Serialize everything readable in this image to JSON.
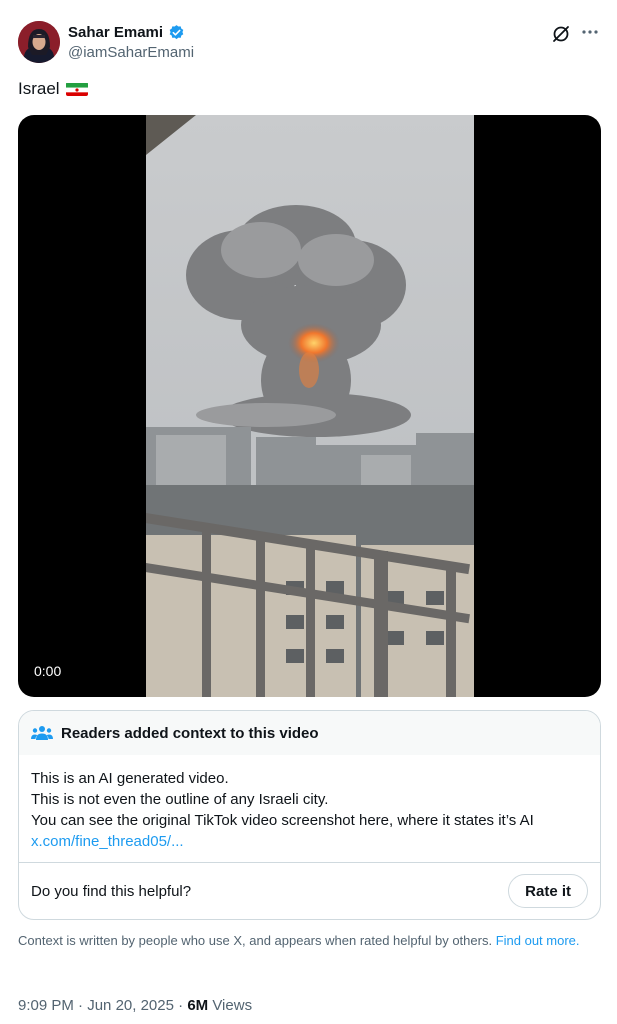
{
  "author": {
    "display_name": "Sahar Emami",
    "handle": "@iamSaharEmami",
    "verified": true
  },
  "header_icons": [
    "grok-icon",
    "more-options-icon"
  ],
  "tweet": {
    "text": "Israel",
    "flag": "iran-flag-icon"
  },
  "video": {
    "timestamp": "0:00"
  },
  "community_note": {
    "title": "Readers added context to this video",
    "lines": [
      "This is an AI generated video.",
      "This is not even the outline of any Israeli city.",
      "You can see the original TikTok video screenshot here, where it states it’s AI"
    ],
    "link_text": "x.com/fine_thread05/...",
    "helpful_question": "Do you find this helpful?",
    "rate_label": "Rate it"
  },
  "disclaimer": {
    "text": "Context is written by people who use X, and appears when rated helpful by others.",
    "link_text": "Find out more."
  },
  "meta": {
    "time": "9:09 PM",
    "separator": "·",
    "date": "Jun 20, 2025",
    "views_count": "6M",
    "views_label": "Views"
  },
  "colors": {
    "accent": "#1d9bf0",
    "secondary_text": "#536471",
    "border": "#cfd9de"
  }
}
